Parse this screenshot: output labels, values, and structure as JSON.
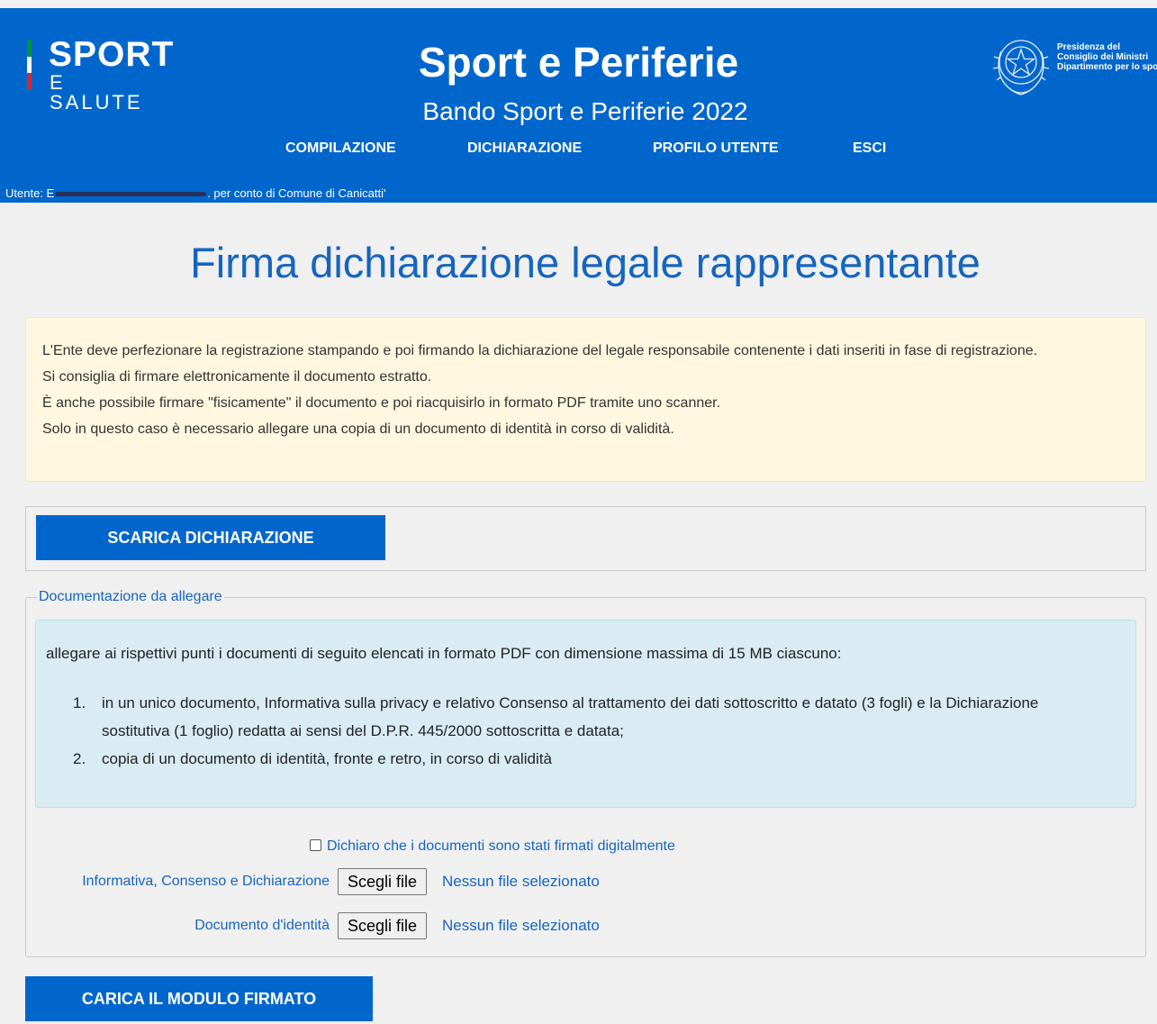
{
  "header": {
    "logo_line1": "SPORT",
    "logo_line2": "E SALUTE",
    "flag_colors": [
      "#009246",
      "#ffffff",
      "#ce2b37"
    ],
    "title": "Sport e Periferie",
    "subtitle": "Bando Sport e Periferie 2022",
    "seal_text": [
      "Presidenza del",
      "Consiglio dei Ministri",
      "Dipartimento per lo sport"
    ],
    "nav": [
      "COMPILAZIONE",
      "DICHIARAZIONE",
      "PROFILO UTENTE",
      "ESCI"
    ],
    "user_prefix": "Utente: E",
    "user_suffix": ". per conto di Comune di Canicatti'"
  },
  "page_title": "Firma dichiarazione legale rappresentante",
  "warning": [
    "L'Ente deve perfezionare la registrazione stampando e poi firmando la dichiarazione del legale responsabile contenente i dati inseriti in fase di registrazione.",
    "Si consiglia di firmare elettronicamente il documento estratto.",
    "È anche possibile firmare \"fisicamente\" il documento e poi riacquisirlo in formato PDF tramite uno scanner.",
    "Solo in questo caso è necessario allegare una copia di un documento di identità in corso di validità."
  ],
  "download_button": "SCARICA DICHIARAZIONE",
  "attachments": {
    "legend": "Documentazione da allegare",
    "intro": "allegare ai rispettivi punti i documenti di seguito elencati in formato PDF con dimensione massima di 15 MB ciascuno:",
    "items": [
      {
        "num": "1.",
        "text": "in un unico documento, Informativa sulla privacy e relativo Consenso al trattamento dei dati sottoscritto e datato (3 fogli) e la Dichiarazione sostitutiva (1 foglio) redatta ai sensi del D.P.R. 445/2000 sottoscritta e datata;"
      },
      {
        "num": "2.",
        "text": "copia di un documento di identità, fronte e retro, in corso di validità"
      }
    ],
    "checkbox_label": "Dichiaro che i documenti sono stati firmati digitalmente",
    "file_rows": [
      {
        "label": "Informativa, Consenso e Dichiarazione",
        "button": "Scegli file",
        "status": "Nessun file selezionato"
      },
      {
        "label": "Documento d'identità",
        "button": "Scegli file",
        "status": "Nessun file selezionato"
      }
    ]
  },
  "upload_button": "CARICA IL MODULO FIRMATO"
}
